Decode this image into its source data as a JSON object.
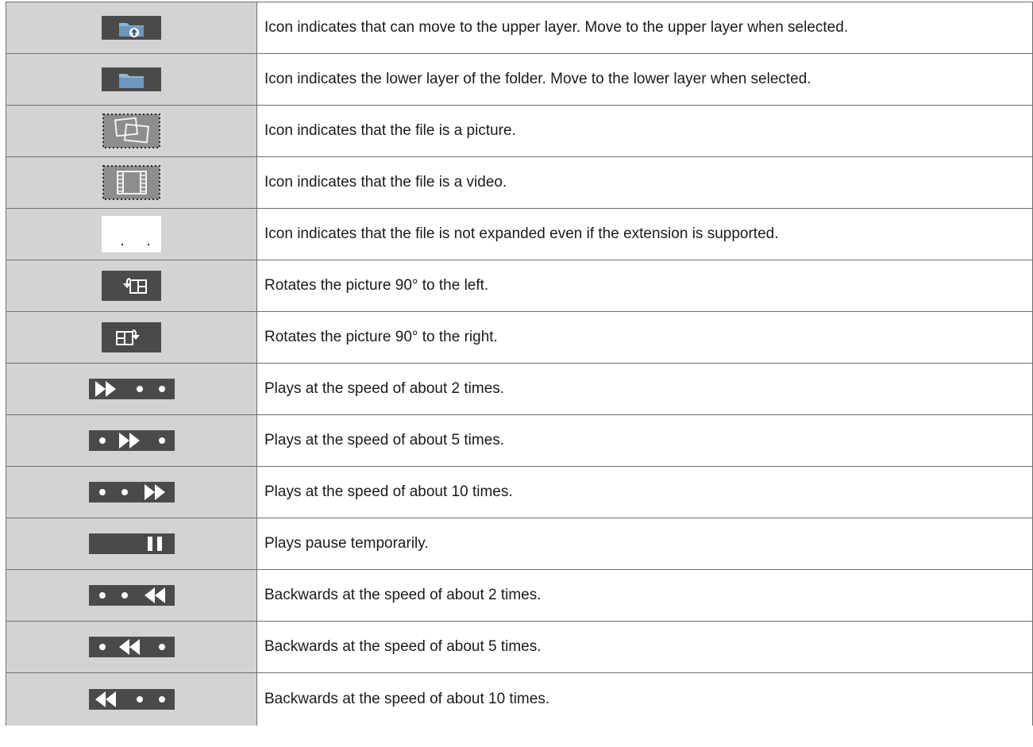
{
  "colors": {
    "icon_cell_bg": "#d3d3d5",
    "icon_dark": "#4a4a4a",
    "folder_blue": "#7fa7c8",
    "border": "#6e6e6e"
  },
  "rows": [
    {
      "icon": "folder-up-icon",
      "description": "Icon indicates that can move to the upper layer. Move to the upper layer when selected."
    },
    {
      "icon": "folder-icon",
      "description": "Icon indicates the lower layer of the folder. Move to the lower layer when selected."
    },
    {
      "icon": "picture-file-icon",
      "description": "Icon indicates that the file is a picture."
    },
    {
      "icon": "video-file-icon",
      "description": "Icon indicates that the file is a video."
    },
    {
      "icon": "unsupported-file-icon",
      "description": "Icon indicates that the file is not expanded even if the extension is supported."
    },
    {
      "icon": "rotate-left-icon",
      "description": "Rotates the picture 90° to the left."
    },
    {
      "icon": "rotate-right-icon",
      "description": "Rotates the picture 90° to the right."
    },
    {
      "icon": "fast-forward-2x-icon",
      "description": "Plays at the speed of about 2 times."
    },
    {
      "icon": "fast-forward-5x-icon",
      "description": "Plays at the speed of about 5 times."
    },
    {
      "icon": "fast-forward-10x-icon",
      "description": "Plays at the speed of about 10 times."
    },
    {
      "icon": "pause-icon",
      "description": "Plays pause temporarily."
    },
    {
      "icon": "rewind-2x-icon",
      "description": "Backwards at the speed of about 2 times."
    },
    {
      "icon": "rewind-5x-icon",
      "description": "Backwards at the speed of about 5 times."
    },
    {
      "icon": "rewind-10x-icon",
      "description": "Backwards at the speed of about 10 times."
    }
  ]
}
